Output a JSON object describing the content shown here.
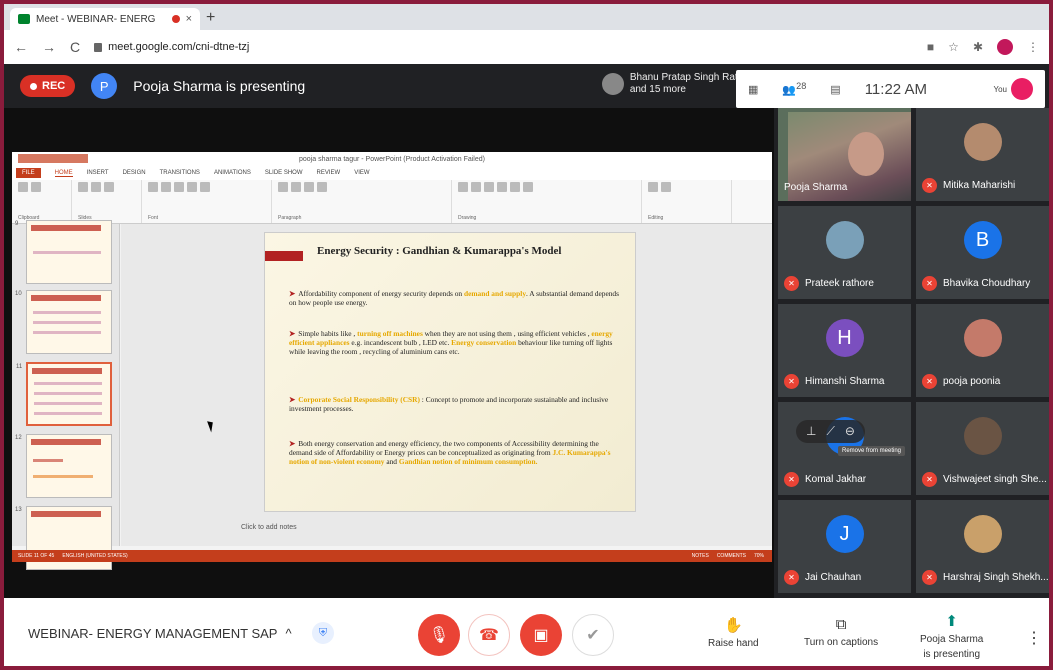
{
  "browser": {
    "tab_title": "Meet - WEBINAR- ENERG",
    "tab_close": "×",
    "new_tab": "+",
    "url": "meet.google.com/cni-dtne-tzj",
    "nav": [
      "←",
      "→",
      "C"
    ]
  },
  "meet_top": {
    "rec_label": "REC",
    "presenter_initial": "P",
    "presenting_text": "Pooja Sharma is presenting",
    "people_peek_line1": "Bhanu Pratap Singh Rat...",
    "people_peek_line2": "and 15 more"
  },
  "info": {
    "participants_count": "28",
    "time": "11:22 AM",
    "you_label": "You"
  },
  "ppt": {
    "window_title": "pooja sharma tagur - PowerPoint (Product Activation Failed)",
    "tabs": [
      "FILE",
      "HOME",
      "INSERT",
      "DESIGN",
      "TRANSITIONS",
      "ANIMATIONS",
      "SLIDE SHOW",
      "REVIEW",
      "VIEW"
    ],
    "groups": [
      "Clipboard",
      "Slides",
      "Font",
      "Paragraph",
      "Drawing",
      "Editing"
    ],
    "thumb_numbers": [
      "9",
      "10",
      "11",
      "12",
      "13"
    ],
    "slide": {
      "title": "Energy Security :   Gandhian & Kumarappa's Model",
      "p1_a": "Affordability component of energy security depends on ",
      "p1_hl": "demand and supply",
      "p1_b": ". A substantial demand depends on how people use energy.",
      "p2_a": "Simple habits like , ",
      "p2_hl1": "turning off machines",
      "p2_b": " when they are not using them , using efficient vehicles , ",
      "p2_hl2": "energy efficient appliances",
      "p2_c": " e.g. incandescent bulb , LED etc. ",
      "p2_hl3": "Energy conservation",
      "p2_d": " behaviour like turning off lights while leaving the room , recycling of aluminium cans etc.",
      "p3_hl": "Corporate Social Responsibility (CSR)",
      "p3_b": " : Concept to promote and incorporate sustainable and inclusive investment processes.",
      "p4_a": "Both energy conservation and energy efficiency, the two components of Accessibility determining the demand side of Affordability or Energy prices can be conceptualized as originating from ",
      "p4_hl1": "J.C. Kumarappa's notion of non-violent economy",
      "p4_b": " and ",
      "p4_hl2": "Gandhian notion of minimum consumption.",
      "bullet": "➤"
    },
    "notes_placeholder": "Click to add notes",
    "status_left": "SLIDE 11 OF 45",
    "status_lang": "ENGLISH (UNITED STATES)",
    "status_notes": "NOTES",
    "status_comments": "COMMENTS",
    "zoom": "70%"
  },
  "participants": [
    {
      "name": "Pooja Sharma",
      "initial": "",
      "color": "",
      "muted": false,
      "video": true
    },
    {
      "name": "Mitika Maharishi",
      "initial": "",
      "color": "#b48b6e",
      "muted": true
    },
    {
      "name": "Prateek rathore",
      "initial": "",
      "color": "#7aa0b8",
      "muted": true
    },
    {
      "name": "Bhavika Choudhary",
      "initial": "B",
      "color": "#1a73e8",
      "muted": true
    },
    {
      "name": "Himanshi Sharma",
      "initial": "H",
      "color": "#7b4fbf",
      "muted": true
    },
    {
      "name": "pooja poonia",
      "initial": "",
      "color": "#c47a6a",
      "muted": true
    },
    {
      "name": "Komal Jakhar",
      "initial": "",
      "color": "#1a73e8",
      "muted": true
    },
    {
      "name": "Vishwajeet singh She...",
      "initial": "",
      "color": "#6a5444",
      "muted": true
    },
    {
      "name": "Jai Chauhan",
      "initial": "J",
      "color": "#1a73e8",
      "muted": true
    },
    {
      "name": "Harshraj Singh Shekh...",
      "initial": "",
      "color": "#c9a06a",
      "muted": true
    }
  ],
  "hover": {
    "tooltip": "Remove from meeting"
  },
  "bottom": {
    "meeting_name": "WEBINAR- ENERGY MANAGEMENT SAP",
    "chevron": "^",
    "raise_hand": "Raise hand",
    "captions": "Turn on captions",
    "presenting_line1": "Pooja Sharma",
    "presenting_line2": "is presenting",
    "more": "⋮"
  }
}
